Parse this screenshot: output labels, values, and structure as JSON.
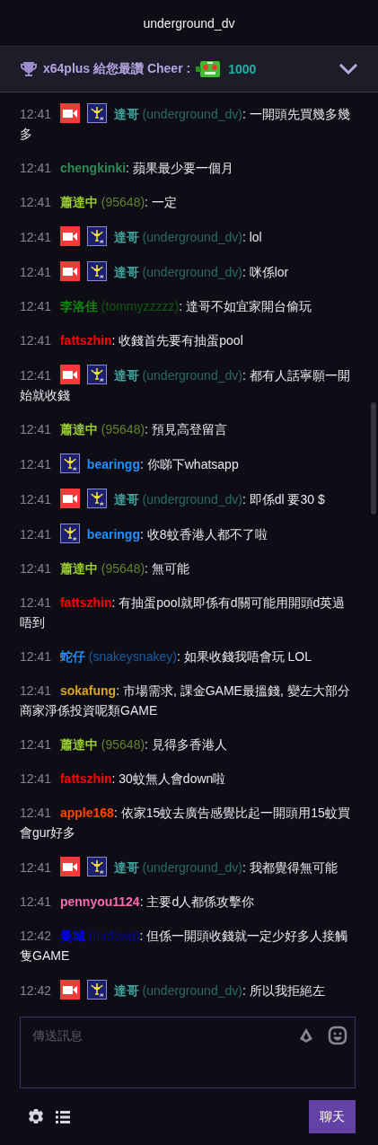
{
  "header": {
    "title": "underground_dv"
  },
  "cheer": {
    "text": "x64plus 給您最讚 Cheer :",
    "amount": "1000"
  },
  "messages": [
    {
      "time": "12:41",
      "broadcaster": true,
      "subscriber": true,
      "name": "達哥",
      "login": "(underground_dv)",
      "color": "#3fa39c",
      "text": ": 一開頭先買幾多幾多"
    },
    {
      "time": "12:41",
      "broadcaster": false,
      "subscriber": false,
      "name": "chengkinki",
      "color": "#2e8b57",
      "text": ": 蘋果最少要一個月"
    },
    {
      "time": "12:41",
      "broadcaster": false,
      "subscriber": false,
      "name": "蕭達中",
      "login": "(95648)",
      "color": "#9acd32",
      "text": ": 一定"
    },
    {
      "time": "12:41",
      "broadcaster": true,
      "subscriber": true,
      "name": "達哥",
      "login": "(underground_dv)",
      "color": "#3fa39c",
      "text": ": lol"
    },
    {
      "time": "12:41",
      "broadcaster": true,
      "subscriber": true,
      "name": "達哥",
      "login": "(underground_dv)",
      "color": "#3fa39c",
      "text": ": 咪係lor"
    },
    {
      "time": "12:41",
      "broadcaster": false,
      "subscriber": false,
      "name": "李洛佳",
      "login": "(tommyzzzzz)",
      "color": "#0f8a0f",
      "text": ": 達哥不如宜家開台偷玩"
    },
    {
      "time": "12:41",
      "broadcaster": false,
      "subscriber": false,
      "name": "fattszhin",
      "color": "#ff0000",
      "text": ": 收錢首先要有抽蛋pool"
    },
    {
      "time": "12:41",
      "broadcaster": true,
      "subscriber": true,
      "name": "達哥",
      "login": "(underground_dv)",
      "color": "#3fa39c",
      "text": ": 都有人話寧願一開始就收錢"
    },
    {
      "time": "12:41",
      "broadcaster": false,
      "subscriber": false,
      "name": "蕭達中",
      "login": "(95648)",
      "color": "#9acd32",
      "text": ": 預見高登留言"
    },
    {
      "time": "12:41",
      "broadcaster": false,
      "subscriber": true,
      "name": "bearingg",
      "color": "#1e90ff",
      "text": ": 你睇下whatsapp"
    },
    {
      "time": "12:41",
      "broadcaster": true,
      "subscriber": true,
      "name": "達哥",
      "login": "(underground_dv)",
      "color": "#3fa39c",
      "text": ": 即係dl 要30 $"
    },
    {
      "time": "12:41",
      "broadcaster": false,
      "subscriber": true,
      "name": "bearingg",
      "color": "#1e90ff",
      "text": ": 收8蚊香港人都不了啦"
    },
    {
      "time": "12:41",
      "broadcaster": false,
      "subscriber": false,
      "name": "蕭達中",
      "login": "(95648)",
      "color": "#9acd32",
      "text": ": 無可能"
    },
    {
      "time": "12:41",
      "broadcaster": false,
      "subscriber": false,
      "name": "fattszhin",
      "color": "#ff0000",
      "text": ": 有抽蛋pool就即係有d關可能用開頭d英過唔到"
    },
    {
      "time": "12:41",
      "broadcaster": false,
      "subscriber": false,
      "name": "蛇仔",
      "login": "(snakeysnakey)",
      "color": "#1e90ff",
      "text": ": 如果收錢我唔會玩 LOL"
    },
    {
      "time": "12:41",
      "broadcaster": false,
      "subscriber": false,
      "name": "sokafung",
      "color": "#daa520",
      "text": ": 市場需求, 課金GAME最搵錢, 變左大部分商家淨係投資呢類GAME"
    },
    {
      "time": "12:41",
      "broadcaster": false,
      "subscriber": false,
      "name": "蕭達中",
      "login": "(95648)",
      "color": "#9acd32",
      "text": ": 見得多香港人"
    },
    {
      "time": "12:41",
      "broadcaster": false,
      "subscriber": false,
      "name": "fattszhin",
      "color": "#ff0000",
      "text": ": 30蚊無人會down啦"
    },
    {
      "time": "12:41",
      "broadcaster": false,
      "subscriber": false,
      "name": "apple168",
      "color": "#ff4500",
      "text": ": 依家15蚊去廣告感覺比起一開頭用15蚊買會gur好多"
    },
    {
      "time": "12:41",
      "broadcaster": true,
      "subscriber": true,
      "name": "達哥",
      "login": "(underground_dv)",
      "color": "#3fa39c",
      "text": ": 我都覺得無可能"
    },
    {
      "time": "12:41",
      "broadcaster": false,
      "subscriber": false,
      "name": "pennyou1124",
      "color": "#ff69b4",
      "text": ": 主要d人都係攻擊你"
    },
    {
      "time": "12:42",
      "broadcaster": false,
      "subscriber": false,
      "name": "曼城",
      "login": "(mcfcwa)",
      "color": "#0000ff",
      "text": ": 但係一開頭收錢就一定少好多人接觸隻GAME"
    },
    {
      "time": "12:42",
      "broadcaster": true,
      "subscriber": true,
      "name": "達哥",
      "login": "(underground_dv)",
      "color": "#3fa39c",
      "text": ": 所以我拒絕左"
    }
  ],
  "composer": {
    "placeholder": "傳送訊息"
  },
  "send_button": "聊天"
}
